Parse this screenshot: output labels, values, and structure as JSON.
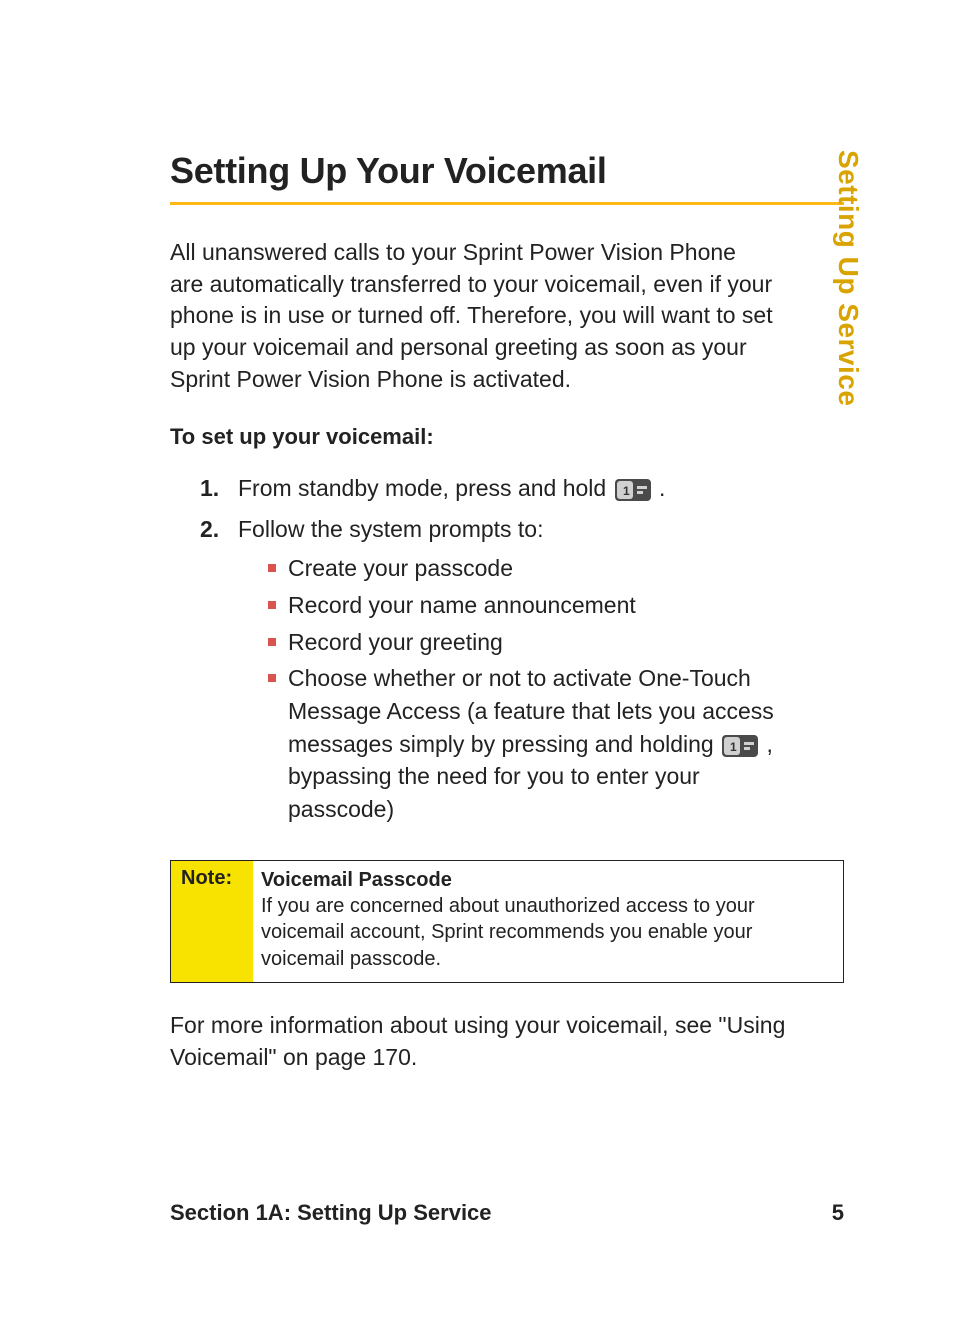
{
  "sideTab": "Setting Up Service",
  "heading": "Setting Up Your Voicemail",
  "intro": "All unanswered calls to your Sprint Power Vision Phone are automatically transferred to your voicemail, even if your phone is in use or turned off. Therefore, you will want to set up your voicemail and personal greeting as soon as your Sprint Power Vision Phone is activated.",
  "subhead": "To set up your voicemail:",
  "steps": [
    {
      "num": "1.",
      "pre": "From standby mode, press and hold ",
      "post": "."
    },
    {
      "num": "2.",
      "text": "Follow the system prompts to:",
      "sub": [
        "Create your passcode",
        "Record your name announcement",
        "Record your greeting"
      ],
      "subLastPre": "Choose whether or not to activate One-Touch Message Access (a feature that lets you access messages simply by pressing and holding ",
      "subLastPost": ", bypassing the need for you to enter your passcode)"
    }
  ],
  "note": {
    "label": "Note:",
    "title": "Voicemail Passcode",
    "body": "If you are concerned about unauthorized access to your voicemail account, Sprint recommends you enable your voicemail passcode."
  },
  "closing": "For more information about using your voicemail, see \"Using Voicemail\" on page 170.",
  "footer": {
    "section": "Section 1A: Setting Up Service",
    "page": "5"
  },
  "chart_data": null
}
